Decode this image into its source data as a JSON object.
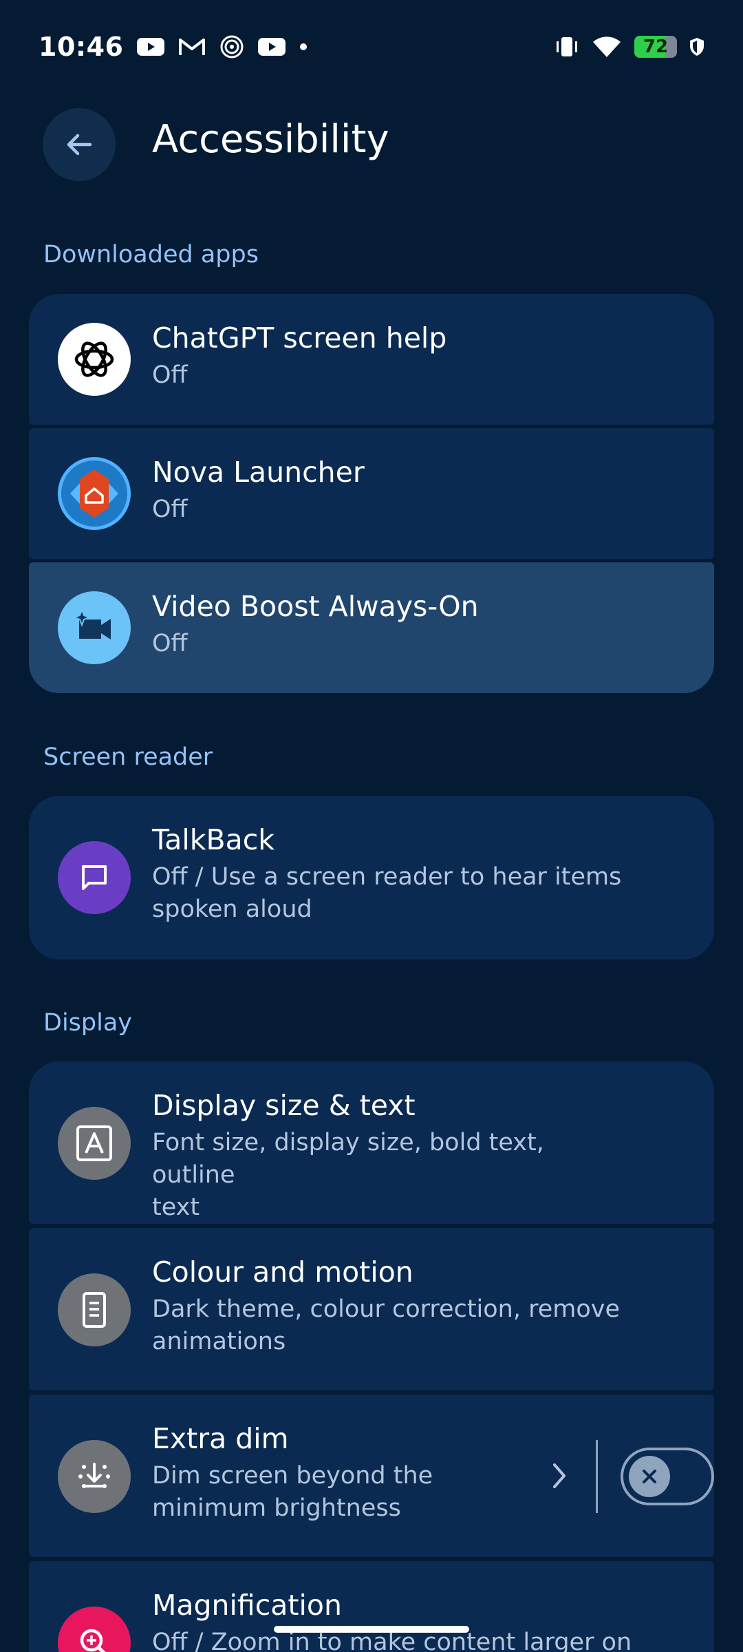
{
  "status_bar": {
    "time": "10:46",
    "notification_icons": [
      "youtube-icon",
      "gmail-icon",
      "spiral-icon",
      "youtube-icon",
      "dot-icon"
    ],
    "battery_level": "72",
    "system_icons": [
      "vibrate-icon",
      "wifi-icon",
      "battery-icon",
      "shield-icon"
    ]
  },
  "header": {
    "title": "Accessibility",
    "back_icon": "arrow-back-icon"
  },
  "sections": {
    "downloaded_apps": {
      "label": "Downloaded apps",
      "items": [
        {
          "title": "ChatGPT screen help",
          "summary": "Off",
          "icon": "chatgpt-icon"
        },
        {
          "title": "Nova Launcher",
          "summary": "Off",
          "icon": "nova-launcher-icon"
        },
        {
          "title": "Video Boost Always-On",
          "summary": "Off",
          "icon": "video-boost-icon"
        }
      ]
    },
    "screen_reader": {
      "label": "Screen reader",
      "items": [
        {
          "title": "TalkBack",
          "summary_line1": "Off / Use a screen reader to hear items",
          "summary_line2": "spoken aloud",
          "icon": "talkback-icon"
        }
      ]
    },
    "display": {
      "label": "Display",
      "items": [
        {
          "title": "Display size & text",
          "summary_line1": "Font size, display size, bold text, outline",
          "summary_line2": "text",
          "icon": "text-size-icon"
        },
        {
          "title": "Colour and motion",
          "summary_line1": "Dark theme, colour correction, remove",
          "summary_line2": "animations",
          "icon": "colour-motion-icon"
        },
        {
          "title": "Extra dim",
          "summary_line1": "Dim screen beyond the",
          "summary_line2": "minimum brightness",
          "icon": "extra-dim-icon",
          "toggle_state": "off"
        },
        {
          "title": "Magnification",
          "summary_line1": "Off / Zoom in to make content larger on",
          "icon": "magnification-icon"
        }
      ]
    }
  },
  "colors": {
    "background": "#051a33",
    "card": "#0a2a52",
    "card_highlight": "#21466e",
    "section_header": "#93c2f7",
    "talkback_purple": "#6a3ec4",
    "magnification_pink": "#e8175d"
  }
}
